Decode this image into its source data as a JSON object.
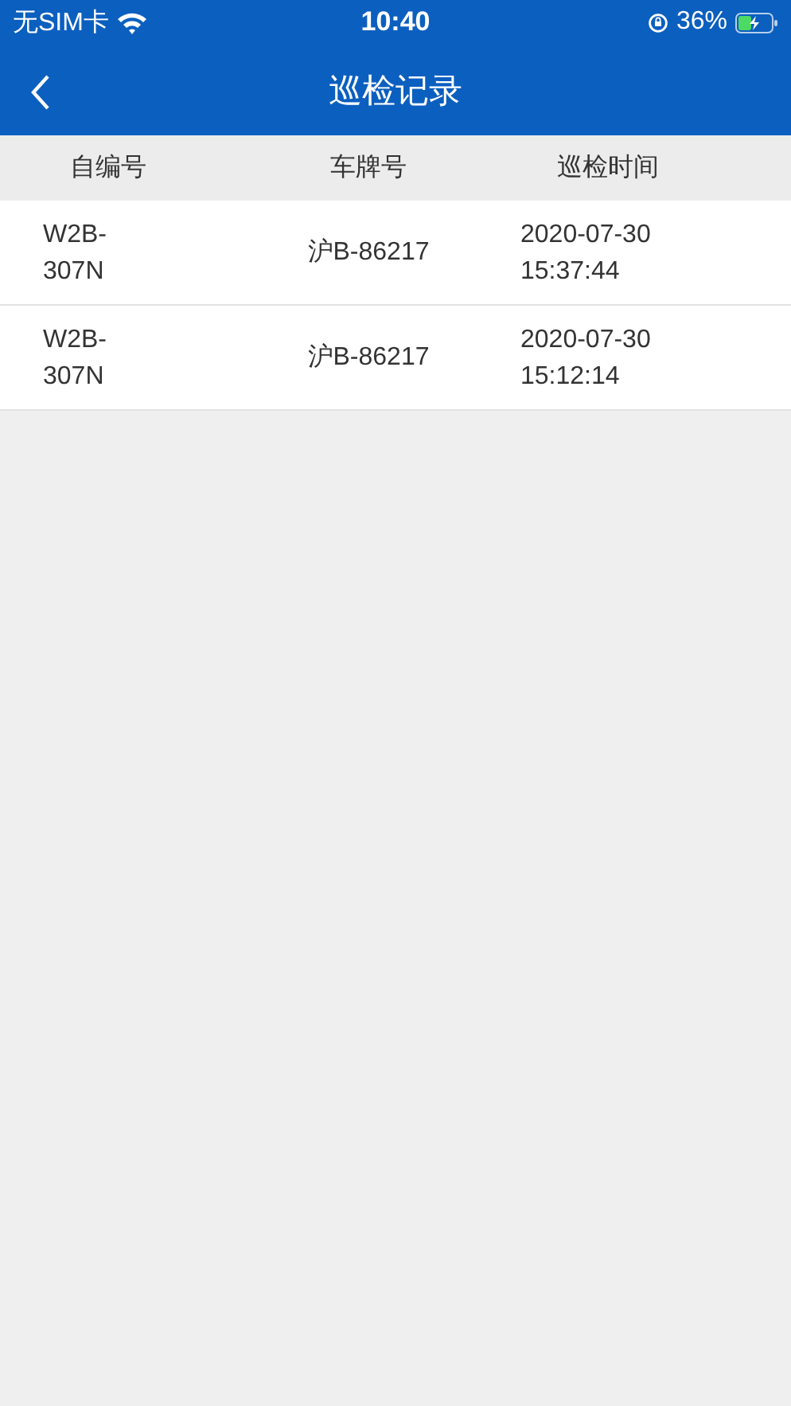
{
  "status_bar": {
    "carrier": "无SIM卡",
    "time": "10:40",
    "battery": "36%"
  },
  "nav_bar": {
    "title": "巡检记录"
  },
  "table": {
    "columns": [
      "自编号",
      "车牌号",
      "巡检时间"
    ],
    "rows": [
      {
        "cells": [
          "W2B-307N",
          "沪B-86217",
          "2020-07-30 15:37:44"
        ]
      },
      {
        "cells": [
          "W2B-307N",
          "沪B-86217",
          "2020-07-30 15:12:14"
        ]
      }
    ]
  }
}
